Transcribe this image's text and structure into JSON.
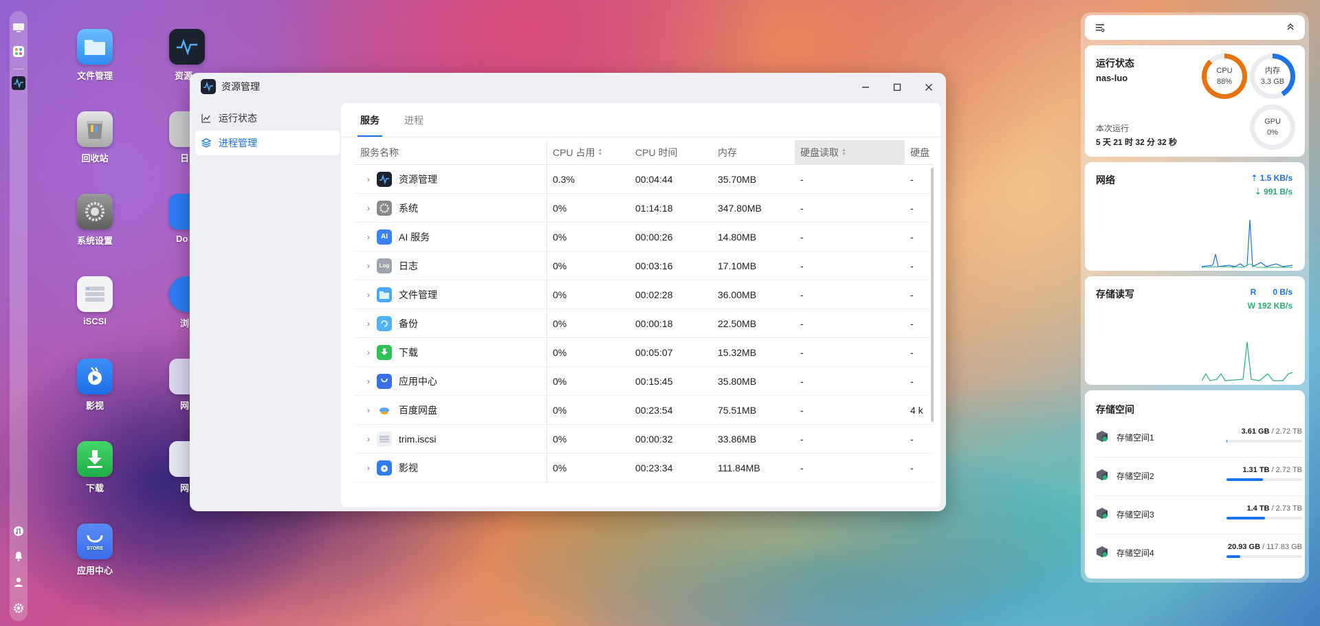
{
  "desktop_icons": [
    {
      "label": "文件管理"
    },
    {
      "label": "资源"
    },
    {
      "label": "回收站"
    },
    {
      "label": "日"
    },
    {
      "label": "系统设置"
    },
    {
      "label": "Do"
    },
    {
      "label": "iSCSI"
    },
    {
      "label": "浏"
    },
    {
      "label": "影视"
    },
    {
      "label": "网"
    },
    {
      "label": "下载"
    },
    {
      "label": "网"
    },
    {
      "label": "应用中心"
    }
  ],
  "window": {
    "title": "资源管理",
    "sidebar": [
      {
        "label": "运行状态",
        "icon": "line-chart-icon"
      },
      {
        "label": "进程管理",
        "icon": "layers-icon"
      }
    ],
    "tabs": [
      {
        "label": "服务"
      },
      {
        "label": "进程"
      }
    ],
    "columns": [
      "服务名称",
      "CPU 占用",
      "CPU 时间",
      "内存",
      "硬盘读取",
      "硬盘"
    ],
    "rows": [
      {
        "name": "资源管理",
        "cpu": "0.3%",
        "time": "00:04:44",
        "mem": "35.70MB",
        "read": "-",
        "write": "-"
      },
      {
        "name": "系统",
        "cpu": "0%",
        "time": "01:14:18",
        "mem": "347.80MB",
        "read": "-",
        "write": "-"
      },
      {
        "name": "AI 服务",
        "cpu": "0%",
        "time": "00:00:26",
        "mem": "14.80MB",
        "read": "-",
        "write": "-"
      },
      {
        "name": "日志",
        "cpu": "0%",
        "time": "00:03:16",
        "mem": "17.10MB",
        "read": "-",
        "write": "-"
      },
      {
        "name": "文件管理",
        "cpu": "0%",
        "time": "00:02:28",
        "mem": "36.00MB",
        "read": "-",
        "write": "-"
      },
      {
        "name": "备份",
        "cpu": "0%",
        "time": "00:00:18",
        "mem": "22.50MB",
        "read": "-",
        "write": "-"
      },
      {
        "name": "下载",
        "cpu": "0%",
        "time": "00:05:07",
        "mem": "15.32MB",
        "read": "-",
        "write": "-"
      },
      {
        "name": "应用中心",
        "cpu": "0%",
        "time": "00:15:45",
        "mem": "35.80MB",
        "read": "-",
        "write": "-"
      },
      {
        "name": "百度网盘",
        "cpu": "0%",
        "time": "00:23:54",
        "mem": "75.51MB",
        "read": "-",
        "write": "4 k"
      },
      {
        "name": "trim.iscsi",
        "cpu": "0%",
        "time": "00:00:32",
        "mem": "33.86MB",
        "read": "-",
        "write": "-"
      },
      {
        "name": "影视",
        "cpu": "0%",
        "time": "00:23:34",
        "mem": "111.84MB",
        "read": "-",
        "write": "-"
      }
    ]
  },
  "widgets": {
    "status": {
      "title": "运行状态",
      "host": "nas-luo",
      "uptime_label": "本次运行",
      "uptime": "5 天 21 时 32 分 32 秒",
      "cpu_label": "CPU",
      "cpu_value": "88%",
      "cpu_fraction": 0.88,
      "mem_label": "内存",
      "mem_value": "3.3 GB",
      "mem_fraction": 0.42,
      "gpu_label": "GPU",
      "gpu_value": "0%",
      "gpu_fraction": 0
    },
    "network": {
      "title": "网络",
      "up": "1.5 KB/s",
      "down": "991 B/s"
    },
    "storage_io": {
      "title": "存储读写",
      "read_label": "R",
      "read": "0 B/s",
      "write": "W 192 KB/s"
    },
    "storage": {
      "title": "存储空间",
      "volumes": [
        {
          "name": "存储空间1",
          "used": "3.61 GB",
          "total": "/ 2.72 TB",
          "fraction": 0.01
        },
        {
          "name": "存储空间2",
          "used": "1.31 TB",
          "total": "/ 2.72 TB",
          "fraction": 0.48
        },
        {
          "name": "存储空间3",
          "used": "1.4 TB",
          "total": "/ 2.73 TB",
          "fraction": 0.51
        },
        {
          "name": "存储空间4",
          "used": "20.93 GB",
          "total": "/ 117.83 GB",
          "fraction": 0.18
        }
      ]
    }
  },
  "colors": {
    "accent": "#1a73e8",
    "cpu_ring": "#e8720c",
    "mem_ring": "#1a73e8",
    "io_line": "#27b079"
  }
}
